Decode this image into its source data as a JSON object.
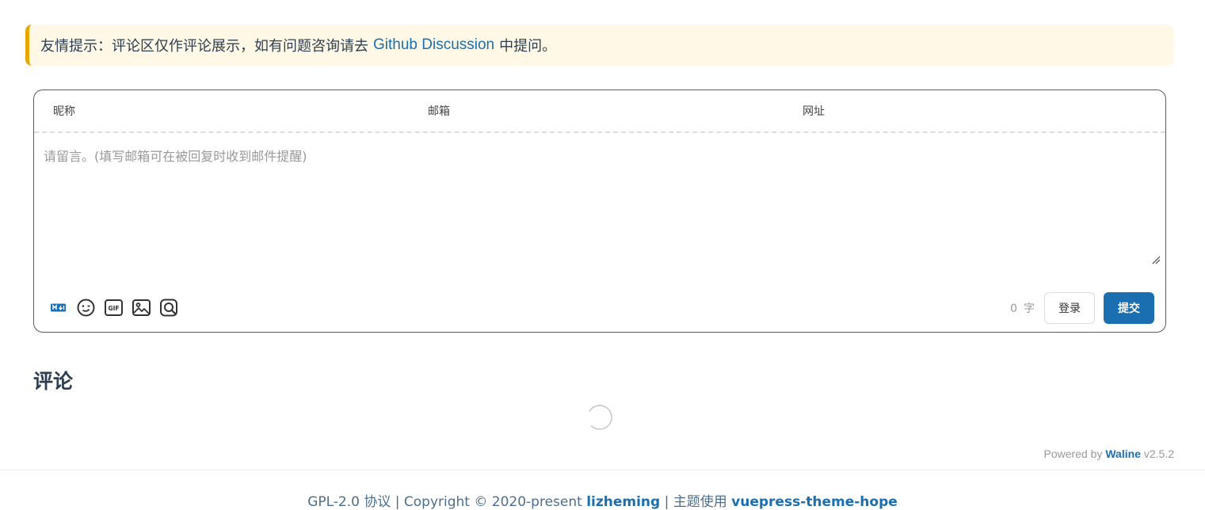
{
  "notice": {
    "prefix": "友情提示：评论区仅作评论展示，如有问题咨询请去",
    "link": "Github Discussion",
    "suffix": "中提问。"
  },
  "comment_form": {
    "fields": {
      "nick": "昵称",
      "email": "邮箱",
      "link": "网址"
    },
    "editor_placeholder": "请留言。(填写邮箱可在被回复时收到邮件提醒)",
    "toolbar_icons": [
      "markdown-icon",
      "emoji-icon",
      "gif-icon",
      "image-icon",
      "preview-icon"
    ],
    "word_count": "0",
    "word_unit": "字",
    "login_label": "登录",
    "submit_label": "提交"
  },
  "comments": {
    "title": "评论"
  },
  "powered": {
    "prefix": "Powered by",
    "brand": "Waline",
    "version": "v2.5.2"
  },
  "footer": {
    "license": "GPL-2.0 协议 | Copyright © 2020-present",
    "author": "lizheming",
    "theme_prefix": "| 主题使用",
    "theme": "vuepress-theme-hope"
  },
  "colors": {
    "accent": "#1a6fb0",
    "tip_bg": "#fff8e6",
    "tip_border": "#e6a700"
  }
}
